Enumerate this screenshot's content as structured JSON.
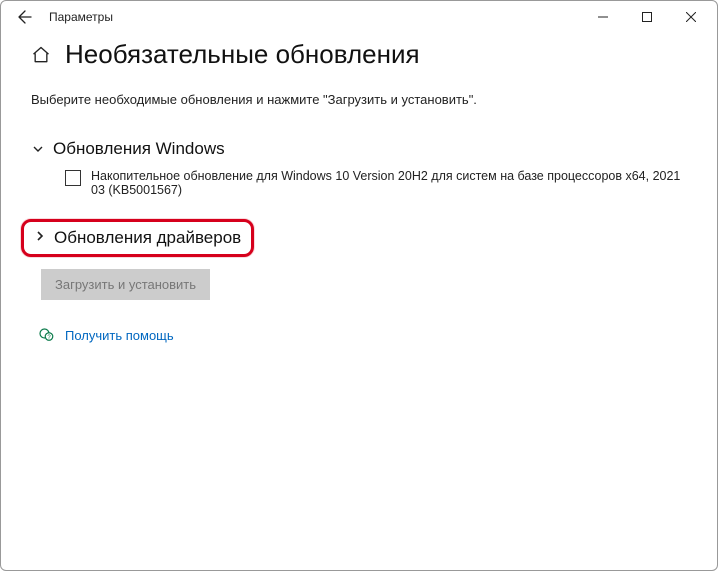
{
  "window": {
    "title": "Параметры"
  },
  "page": {
    "heading": "Необязательные обновления",
    "description": "Выберите необходимые обновления и нажмите \"Загрузить и установить\"."
  },
  "sections": {
    "windows_updates": {
      "title": "Обновления Windows",
      "items": [
        {
          "label": "Накопительное обновление для Windows 10 Version 20H2 для систем на базе процессоров x64, 2021 03 (KB5001567)"
        }
      ]
    },
    "driver_updates": {
      "title": "Обновления драйверов"
    }
  },
  "buttons": {
    "download_install": "Загрузить и установить"
  },
  "help_link": "Получить помощь"
}
